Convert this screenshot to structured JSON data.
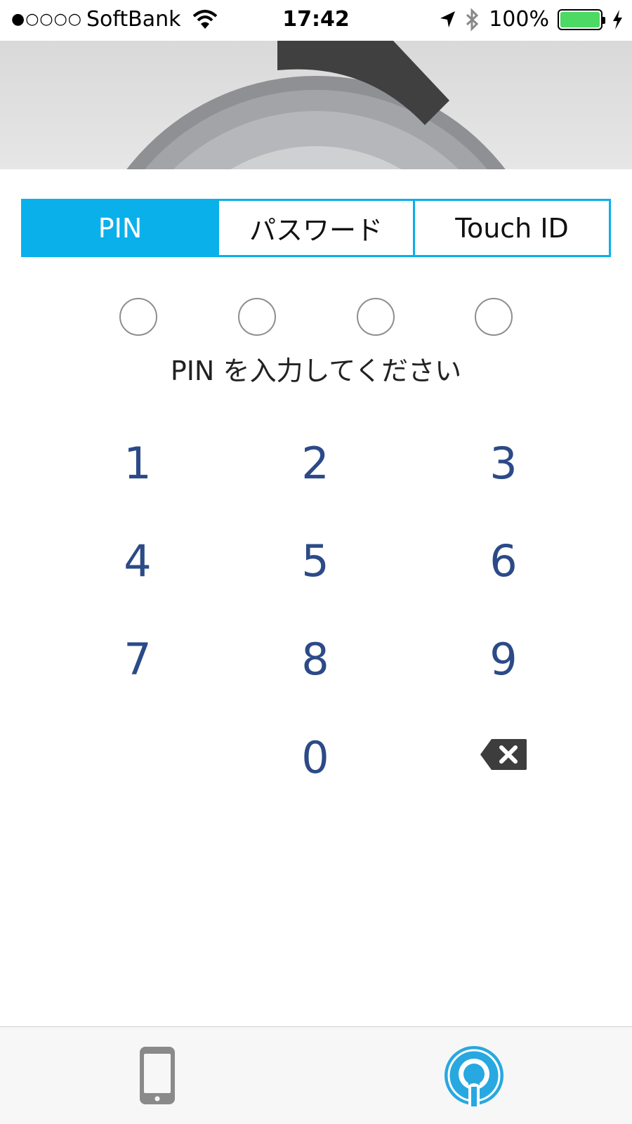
{
  "status_bar": {
    "signal": "●○○○○",
    "carrier": "SoftBank",
    "time": "17:42",
    "battery_percent": "100%",
    "battery_color": "#4cd964"
  },
  "auth_tabs": [
    {
      "label": "PIN",
      "active": true
    },
    {
      "label": "パスワード",
      "active": false
    },
    {
      "label": "Touch ID",
      "active": false
    }
  ],
  "pin": {
    "length": 4,
    "entered": 0,
    "prompt": "PIN を入力してください"
  },
  "keypad": {
    "keys": [
      "1",
      "2",
      "3",
      "4",
      "5",
      "6",
      "7",
      "8",
      "9",
      "0"
    ],
    "delete_icon": "backspace-icon"
  },
  "bottom_bar": {
    "left_icon": "smartphone-icon",
    "right_icon": "app-logo-icon"
  },
  "colors": {
    "accent": "#0ab0ea",
    "digit": "#2c4a87",
    "banner_dark": "#404040"
  }
}
